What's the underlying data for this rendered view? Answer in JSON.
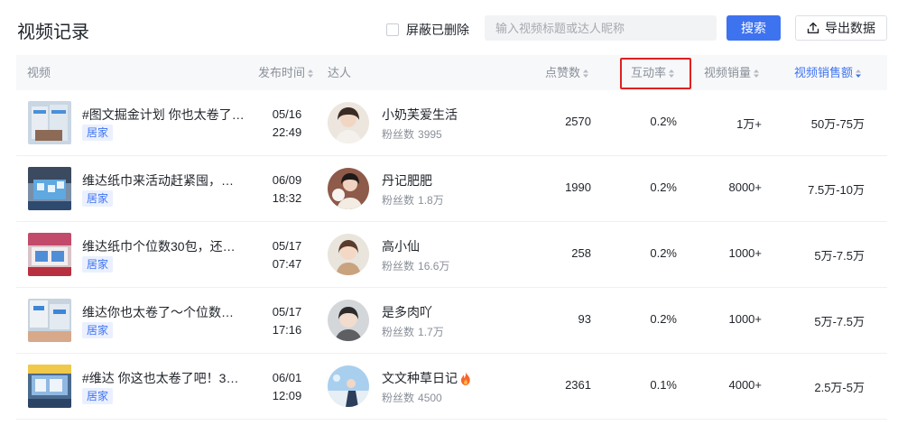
{
  "page": {
    "title": "视频记录"
  },
  "toolbar": {
    "hide_deleted_label": "屏蔽已删除",
    "search_placeholder": "输入视频标题或达人昵称",
    "search_label": "搜索",
    "export_label": "导出数据"
  },
  "table": {
    "headers": {
      "video": "视频",
      "publish_time": "发布时间",
      "influencer": "达人",
      "likes": "点赞数",
      "interaction_rate": "互动率",
      "sales": "视频销量",
      "gmv": "视频销售额"
    },
    "active_sort": "视频销售额",
    "highlighted_column": "互动率",
    "rows": [
      {
        "title": "#图文掘金计划 你也太卷了吧！维达纸巾…",
        "tag": "居家",
        "date": "05/16",
        "time": "22:49",
        "name": "小奶芙爱生活",
        "fans_label": "粉丝数",
        "fans": "3995",
        "flame": false,
        "likes": "2570",
        "rate": "0.2%",
        "sales": "1万+",
        "gmv": "50万-75万"
      },
      {
        "title": "维达纸巾来活动赶紧囤，…",
        "tag": "居家",
        "date": "06/09",
        "time": "18:32",
        "name": "丹记肥肥",
        "fans_label": "粉丝数",
        "fans": "1.8万",
        "flame": false,
        "likes": "1990",
        "rate": "0.2%",
        "sales": "8000+",
        "gmv": "7.5万-10万"
      },
      {
        "title": "维达纸巾个位数30包，还…",
        "tag": "居家",
        "date": "05/17",
        "time": "07:47",
        "name": "高小仙",
        "fans_label": "粉丝数",
        "fans": "16.6万",
        "flame": false,
        "likes": "258",
        "rate": "0.2%",
        "sales": "1000+",
        "gmv": "5万-7.5万"
      },
      {
        "title": "维达你也太卷了～个位数…",
        "tag": "居家",
        "date": "05/17",
        "time": "17:16",
        "name": "是多肉吖",
        "fans_label": "粉丝数",
        "fans": "1.7万",
        "flame": false,
        "likes": "93",
        "rate": "0.2%",
        "sales": "1000+",
        "gmv": "5万-7.5万"
      },
      {
        "title": "#维达 你这也太卷了吧！3…",
        "tag": "居家",
        "date": "06/01",
        "time": "12:09",
        "name": "文文种草日记",
        "fans_label": "粉丝数",
        "fans": "4500",
        "flame": true,
        "likes": "2361",
        "rate": "0.1%",
        "sales": "4000+",
        "gmv": "2.5万-5万"
      }
    ]
  },
  "colors": {
    "accent": "#3e73f0",
    "highlight_border": "#e02020",
    "header_bg": "#f7f8fa",
    "tag_bg": "#eaf0fe",
    "muted_text": "#8a8f99",
    "flame": "#f5682a"
  },
  "icons": {
    "export": "upload-icon",
    "sort": "sort-caret-icon",
    "flame": "flame-icon"
  }
}
